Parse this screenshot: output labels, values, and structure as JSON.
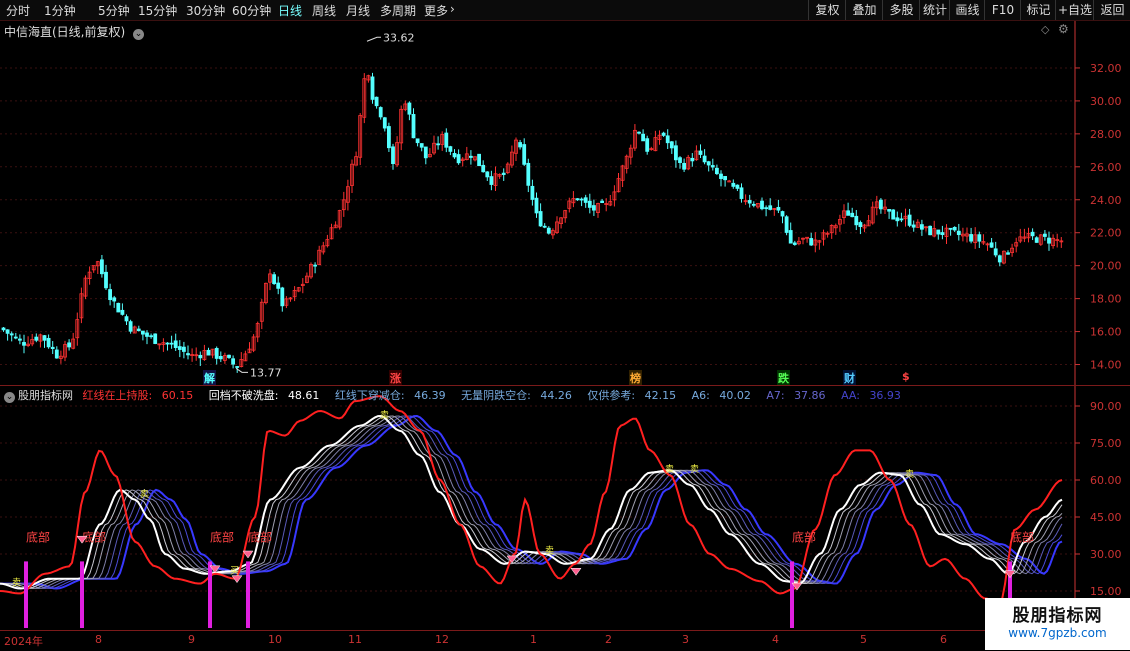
{
  "toolbar": {
    "periods": [
      "分时",
      "1分钟",
      "5分钟",
      "15分钟",
      "30分钟",
      "60分钟",
      "日线",
      "周线",
      "月线",
      "多周期",
      "更多"
    ],
    "active_period": "日线",
    "buttons": [
      "复权",
      "叠加",
      "多股",
      "统计",
      "画线",
      "F10",
      "标记",
      "+自选",
      "返回"
    ]
  },
  "main": {
    "title": "中信海直(日线,前复权)",
    "high_label": "33.62",
    "low_label": "13.77",
    "y_ticks": [
      "32.00",
      "30.00",
      "28.00",
      "26.00",
      "24.00",
      "22.00",
      "20.00",
      "18.00",
      "16.00",
      "14.00"
    ],
    "events": [
      {
        "label": "解",
        "color": "#5ff",
        "bg": "#114"
      },
      {
        "label": "涨",
        "color": "#f44",
        "bg": "#300"
      },
      {
        "label": "榜",
        "color": "#fa3",
        "bg": "#320"
      },
      {
        "label": "跌",
        "color": "#5f5",
        "bg": "#030"
      },
      {
        "label": "财",
        "color": "#5cf",
        "bg": "#013"
      },
      {
        "label": "$",
        "color": "#f44",
        "bg": "#000"
      }
    ]
  },
  "indicator": {
    "name": "股朋指标网",
    "items": [
      {
        "label": "红线在上持股:",
        "value": "60.15",
        "color": "#f33"
      },
      {
        "label": "回档不破洗盘:",
        "value": "48.61",
        "color": "#fff"
      },
      {
        "label": "红线下穿减仓:",
        "value": "46.39",
        "color": "#7ad"
      },
      {
        "label": "无量阴跌空仓:",
        "value": "44.26",
        "color": "#7ad"
      },
      {
        "label": "仅供参考:",
        "value": "42.15",
        "color": "#7ad"
      },
      {
        "label": "A6:",
        "value": "40.02",
        "color": "#7ad"
      },
      {
        "label": "A7:",
        "value": "37.86",
        "color": "#66c"
      },
      {
        "label": "AA:",
        "value": "36.93",
        "color": "#44c"
      }
    ],
    "y_ticks": [
      "90.00",
      "75.00",
      "60.00",
      "45.00",
      "30.00",
      "15.00"
    ],
    "bottom_label": "底部",
    "top_label": "卖",
    "buy_label": "买"
  },
  "timeline": {
    "labels": [
      "2024年",
      "8",
      "9",
      "10",
      "11",
      "12",
      "1",
      "2",
      "3",
      "4",
      "5",
      "6"
    ]
  },
  "watermark": {
    "line1": "股朋指标网",
    "line2": "www.7gpzb.com"
  },
  "colors": {
    "up": "#ff3232",
    "down": "#54ffff",
    "axis": "#c33",
    "grid": "#3a1010",
    "sline": "#ff2020",
    "band": "#3344ff"
  }
}
